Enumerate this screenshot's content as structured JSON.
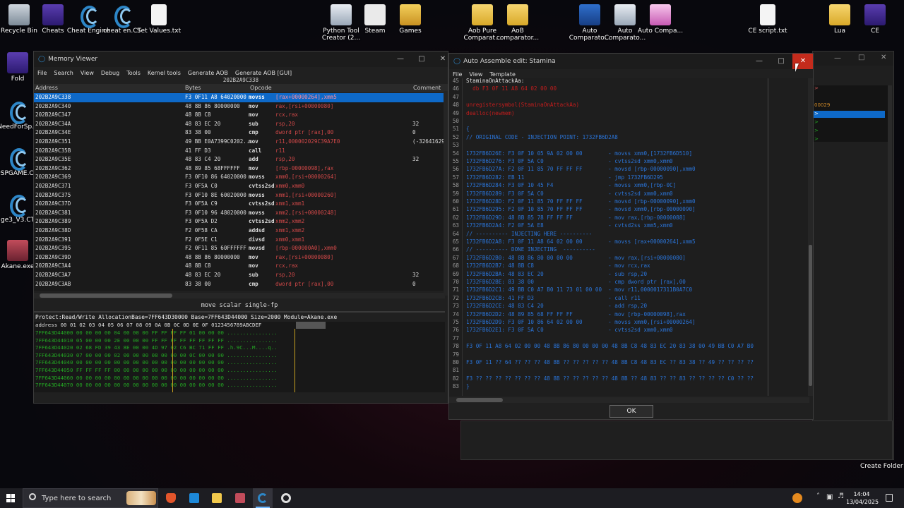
{
  "desktop": {
    "icons_top": [
      "Recycle Bin",
      "Cheats",
      "Cheat Engine",
      "cheat en.CT",
      "Set Values.txt",
      "Python Tool Creator (2...",
      "Steam",
      "Games",
      "Aob Pure Comparat...",
      "AoB comparator...",
      "Auto Comparato...",
      "Auto Comparato...",
      "Auto Compa...",
      "CE script.txt",
      "Lua",
      "CE"
    ],
    "icons_left": [
      "Fold",
      "NeedForSp...",
      "DSPGAME.C...",
      "ge3_V3.CT",
      "Akane.exe"
    ],
    "right_label": "Create Folder"
  },
  "memory_viewer": {
    "title": "Memory Viewer",
    "menu": [
      "File",
      "Search",
      "View",
      "Debug",
      "Tools",
      "Kernel tools",
      "Generate AOB",
      "Generate AOB [GUI]"
    ],
    "current_address": "202B2A9C338",
    "columns": [
      "Address",
      "Bytes",
      "Opcode",
      "Comment"
    ],
    "rows": [
      {
        "addr": "202B2A9C338",
        "bytes": "F3 0F11 A8 64020000",
        "op": "movss",
        "args": "[rax+00000264],xmm5",
        "comment": ""
      },
      {
        "addr": "202B2A9C340",
        "bytes": "48 8B 86 80000000",
        "op": "mov",
        "args": "rax,[rsi+00000080]",
        "comment": ""
      },
      {
        "addr": "202B2A9C347",
        "bytes": "48 8B C8",
        "op": "mov",
        "args": "rcx,rax",
        "comment": ""
      },
      {
        "addr": "202B2A9C34A",
        "bytes": "48 83 EC 20",
        "op": "sub",
        "args": "rsp,20",
        "comment": "32"
      },
      {
        "addr": "202B2A9C34E",
        "bytes": "83 38 00",
        "op": "cmp",
        "args": "dword ptr [rax],00",
        "comment": "0"
      },
      {
        "addr": "202B2A9C351",
        "bytes": "49 BB E0A7399C0202...",
        "op": "mov",
        "args": "r11,000002029C39A7E0",
        "comment": "(-326416295"
      },
      {
        "addr": "202B2A9C35B",
        "bytes": "41 FF D3",
        "op": "call",
        "args": "r11",
        "comment": ""
      },
      {
        "addr": "202B2A9C35E",
        "bytes": "48 83 C4 20",
        "op": "add",
        "args": "rsp,20",
        "comment": "32"
      },
      {
        "addr": "202B2A9C362",
        "bytes": "48 89 85 68FFFFFF",
        "op": "mov",
        "args": "[rbp-00000098],rax",
        "comment": ""
      },
      {
        "addr": "202B2A9C369",
        "bytes": "F3 0F10 86 64020000",
        "op": "movss",
        "args": "xmm0,[rsi+00000264]",
        "comment": ""
      },
      {
        "addr": "202B2A9C371",
        "bytes": "F3 0F5A C0",
        "op": "cvtss2sd",
        "args": "xmm0,xmm0",
        "comment": ""
      },
      {
        "addr": "202B2A9C375",
        "bytes": "F3 0F10 8E 60020000",
        "op": "movss",
        "args": "xmm1,[rsi+00000260]",
        "comment": ""
      },
      {
        "addr": "202B2A9C37D",
        "bytes": "F3 0F5A C9",
        "op": "cvtss2sd",
        "args": "xmm1,xmm1",
        "comment": ""
      },
      {
        "addr": "202B2A9C381",
        "bytes": "F3 0F10 96 48020000",
        "op": "movss",
        "args": "xmm2,[rsi+00000248]",
        "comment": ""
      },
      {
        "addr": "202B2A9C389",
        "bytes": "F3 0F5A D2",
        "op": "cvtss2sd",
        "args": "xmm2,xmm2",
        "comment": ""
      },
      {
        "addr": "202B2A9C38D",
        "bytes": "F2 0F58 CA",
        "op": "addsd",
        "args": "xmm1,xmm2",
        "comment": ""
      },
      {
        "addr": "202B2A9C391",
        "bytes": "F2 0F5E C1",
        "op": "divsd",
        "args": "xmm0,xmm1",
        "comment": ""
      },
      {
        "addr": "202B2A9C395",
        "bytes": "F2 0F11 85 60FFFFFF",
        "op": "movsd",
        "args": "[rbp-000000A0],xmm0",
        "comment": ""
      },
      {
        "addr": "202B2A9C39D",
        "bytes": "48 8B 86 80000000",
        "op": "mov",
        "args": "rax,[rsi+00000080]",
        "comment": ""
      },
      {
        "addr": "202B2A9C3A4",
        "bytes": "48 8B C8",
        "op": "mov",
        "args": "rcx,rax",
        "comment": ""
      },
      {
        "addr": "202B2A9C3A7",
        "bytes": "48 83 EC 20",
        "op": "sub",
        "args": "rsp,20",
        "comment": "32"
      },
      {
        "addr": "202B2A9C3AB",
        "bytes": "83 38 00",
        "op": "cmp",
        "args": "dword ptr [rax],00",
        "comment": "0"
      }
    ],
    "status": "move scalar single-fp",
    "hex_info": "Protect:Read/Write  AllocationBase=7FF643D30000 Base=7FF643D44000 Size=2000 Module=Akane.exe",
    "hex_header": "address      00 01 02 03 04 05 06 07 08 09 0A 0B 0C 0D 0E 0F 0123456789ABCDEF",
    "hex_rows": [
      "7FF643D44000  00 00 00 00 04 00 00 00 FF FF FF FF 01 00 00 00 ................",
      "7FF643D44010  05 00 00 00 2E 00 00 00 FF FF FF FF FF FF FF FF ................",
      "7FF643D44020  02 68 FD 39 43 8E 00 00 4D 97 02 C6 BC 71 FF FF .h.9C...M....q..",
      "7FF643D44030  07 00 00 00 02 00 00 00 08 00 00 00 0C 00 00 00 ................",
      "7FF643D44040  00 00 00 00 00 00 00 00 00 00 00 00 00 00 00 00 ................",
      "7FF643D44050  FF FF FF FF 00 00 00 00 00 00 00 00 00 00 00 00 ................",
      "7FF643D44060  00 00 00 00 00 00 00 00 00 00 00 00 00 00 00 00 ................",
      "7FF643D44070  00 00 00 00 00 00 00 00 00 00 00 00 00 00 00 00 ................"
    ]
  },
  "auto_assemble": {
    "title": "Auto Assemble edit: Stamina",
    "menu": [
      "File",
      "View",
      "Template"
    ],
    "ok_label": "OK",
    "lines": [
      {
        "n": "45",
        "t": "StaminaOnAttackAa:",
        "c": "c-dflt"
      },
      {
        "n": "46",
        "t": "  db F3 0F 11 A8 64 02 00 00",
        "c": "c-red"
      },
      {
        "n": "47",
        "t": "",
        "c": "c-dflt"
      },
      {
        "n": "48",
        "t": "unregistersymbol(StaminaOnAttackAa)",
        "c": "c-red"
      },
      {
        "n": "49",
        "t": "dealloc(newmem)",
        "c": "c-red"
      },
      {
        "n": "50",
        "t": "",
        "c": "c-dflt"
      },
      {
        "n": "51",
        "t": "{",
        "c": "c-com"
      },
      {
        "n": "52",
        "t": "// ORIGINAL CODE - INJECTION POINT: 1732FB6D2A8",
        "c": "c-com"
      },
      {
        "n": "53",
        "t": "",
        "c": "c-dflt"
      },
      {
        "n": "54",
        "t": "1732FB6D26E: F3 0F 10 05 9A 02 00 00        - movss xmm0,[1732FB6D510]",
        "c": "c-com"
      },
      {
        "n": "55",
        "t": "1732FB6D276: F3 0F 5A C0                    - cvtss2sd xmm0,xmm0",
        "c": "c-com"
      },
      {
        "n": "56",
        "t": "1732FB6D27A: F2 0F 11 85 70 FF FF FF        - movsd [rbp-00000090],xmm0",
        "c": "c-com"
      },
      {
        "n": "57",
        "t": "1732FB6D282: EB 11                          - jmp 1732FB6D295",
        "c": "c-com"
      },
      {
        "n": "58",
        "t": "1732FB6D284: F3 0F 10 45 F4                 - movss xmm0,[rbp-0C]",
        "c": "c-com"
      },
      {
        "n": "59",
        "t": "1732FB6D289: F3 0F 5A C0                    - cvtss2sd xmm0,xmm0",
        "c": "c-com"
      },
      {
        "n": "60",
        "t": "1732FB6D28D: F2 0F 11 85 70 FF FF FF        - movsd [rbp-00000090],xmm0",
        "c": "c-com"
      },
      {
        "n": "61",
        "t": "1732FB6D295: F2 0F 10 85 70 FF FF FF        - movsd xmm0,[rbp-00000090]",
        "c": "c-com"
      },
      {
        "n": "62",
        "t": "1732FB6D29D: 48 8B 85 78 FF FF FF           - mov rax,[rbp-00000088]",
        "c": "c-com"
      },
      {
        "n": "63",
        "t": "1732FB6D2A4: F2 0F 5A E8                    - cvtsd2ss xmm5,xmm0",
        "c": "c-com"
      },
      {
        "n": "64",
        "t": "// ---------- INJECTING HERE ----------",
        "c": "c-com"
      },
      {
        "n": "65",
        "t": "1732FB6D2A8: F3 0F 11 A8 64 02 00 00        - movss [rax+00000264],xmm5",
        "c": "c-com"
      },
      {
        "n": "66",
        "t": "// ---------- DONE INJECTING  ----------",
        "c": "c-com"
      },
      {
        "n": "67",
        "t": "1732FB6D2B0: 48 8B 86 80 00 00 00           - mov rax,[rsi+00000080]",
        "c": "c-com"
      },
      {
        "n": "68",
        "t": "1732FB6D2B7: 48 8B C8                       - mov rcx,rax",
        "c": "c-com"
      },
      {
        "n": "69",
        "t": "1732FB6D2BA: 48 83 EC 20                    - sub rsp,20",
        "c": "c-com"
      },
      {
        "n": "70",
        "t": "1732FB6D2BE: 83 38 00                       - cmp dword ptr [rax],00",
        "c": "c-com"
      },
      {
        "n": "71",
        "t": "1732FB6D2C1: 49 BB C0 A7 B0 11 73 01 00 00  - mov r11,0000017311B0A7C0",
        "c": "c-com"
      },
      {
        "n": "72",
        "t": "1732FB6D2CB: 41 FF D3                       - call r11",
        "c": "c-com"
      },
      {
        "n": "73",
        "t": "1732FB6D2CE: 48 83 C4 20                    - add rsp,20",
        "c": "c-com"
      },
      {
        "n": "74",
        "t": "1732FB6D2D2: 48 89 85 68 FF FF FF           - mov [rbp-00000098],rax",
        "c": "c-com"
      },
      {
        "n": "75",
        "t": "1732FB6D2D9: F3 0F 10 86 64 02 00 00        - movss xmm0,[rsi+00000264]",
        "c": "c-com"
      },
      {
        "n": "76",
        "t": "1732FB6D2E1: F3 0F 5A C0                    - cvtss2sd xmm0,xmm0",
        "c": "c-com"
      },
      {
        "n": "77",
        "t": "",
        "c": "c-dflt"
      },
      {
        "n": "78",
        "t": "F3 0F 11 A8 64 02 00 00 48 8B 86 80 00 00 00 48 8B C8 48 83 EC 20 83 38 00 49 BB C0 A7 B0",
        "c": "c-com"
      },
      {
        "n": "79",
        "t": "",
        "c": "c-dflt"
      },
      {
        "n": "80",
        "t": "F3 0F 11 ?? 64 ?? ?? ?? 48 8B ?? ?? ?? ?? ?? 48 8B C8 48 83 EC ?? 83 38 ?? 49 ?? ?? ?? ??",
        "c": "c-com"
      },
      {
        "n": "81",
        "t": "",
        "c": "c-dflt"
      },
      {
        "n": "82",
        "t": "F3 ?? ?? ?? ?? ?? ?? ?? 48 8B ?? ?? ?? ?? ?? 48 8B ?? 48 83 ?? ?? 83 ?? ?? ?? ?? C0 ?? ??",
        "c": "c-com"
      },
      {
        "n": "83",
        "t": "}",
        "c": "c-com"
      }
    ]
  },
  "bg_window": {
    "lines": [
      "00029"
    ]
  },
  "taskbar": {
    "search_placeholder": "Type here to search",
    "time": "14:04",
    "date": "13/04/2025"
  }
}
